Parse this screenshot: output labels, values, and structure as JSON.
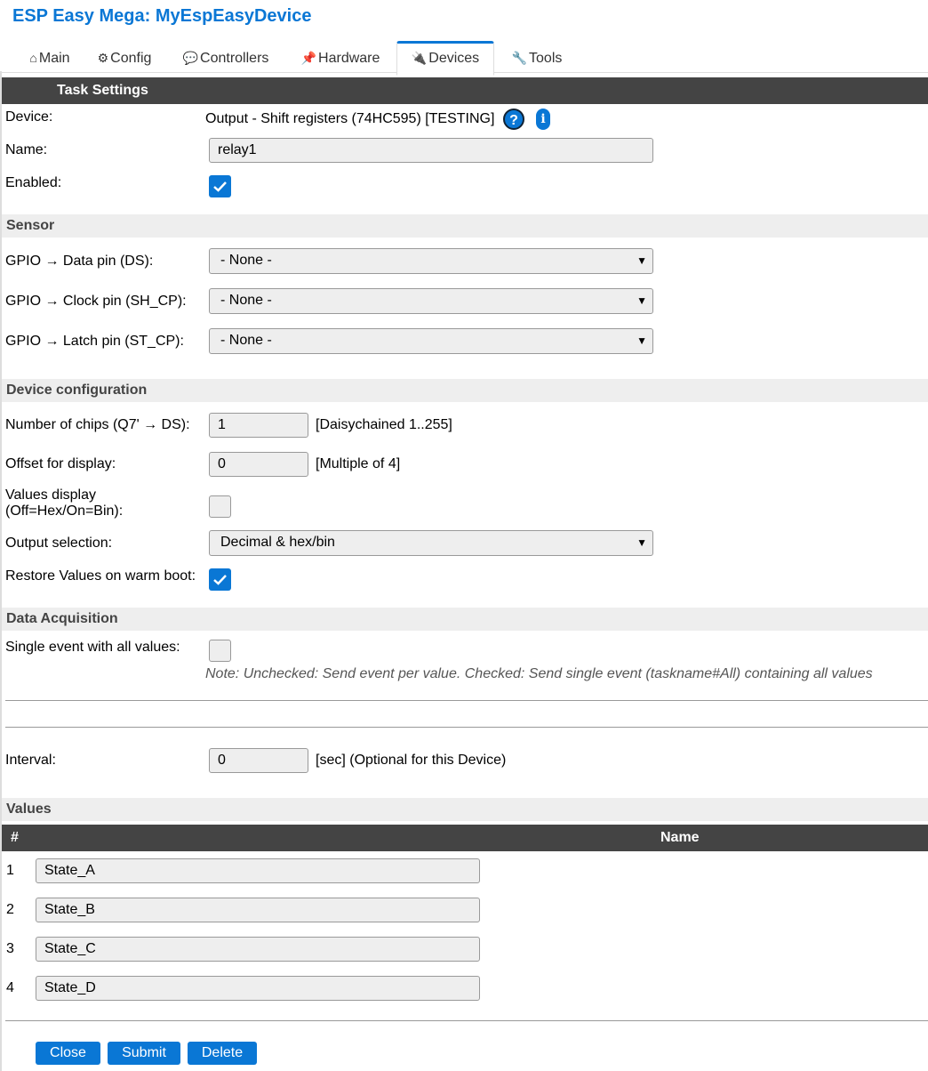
{
  "app": {
    "title": "ESP Easy Mega: MyEspEasyDevice"
  },
  "tabs": [
    {
      "label": "Main",
      "icon": "house-icon",
      "glyph": "⌂"
    },
    {
      "label": "Config",
      "icon": "gear-icon",
      "glyph": "⚙"
    },
    {
      "label": "Controllers",
      "icon": "chat-icon",
      "glyph": "💬"
    },
    {
      "label": "Hardware",
      "icon": "pin-icon",
      "glyph": "📌"
    },
    {
      "label": "Devices",
      "icon": "plug-icon",
      "glyph": "🔌",
      "active": true
    },
    {
      "label": "Tools",
      "icon": "wrench-icon",
      "glyph": "🔧"
    }
  ],
  "task": {
    "header": "Task Settings",
    "device_label": "Device:",
    "device_value": "Output - Shift registers (74HC595) [TESTING]",
    "help_glyph": "?",
    "info_glyph": "i",
    "name_label": "Name:",
    "name_value": "relay1",
    "enabled_label": "Enabled:",
    "enabled": true
  },
  "sensor": {
    "header": "Sensor",
    "rows": [
      {
        "label": "GPIO → Data pin (DS):",
        "value": "- None -"
      },
      {
        "label": "GPIO → Clock pin (SH_CP):",
        "value": "- None -"
      },
      {
        "label": "GPIO → Latch pin (ST_CP):",
        "value": "- None -"
      }
    ]
  },
  "config": {
    "header": "Device configuration",
    "chips_label": "Number of chips (Q7' → DS):",
    "chips_value": "1",
    "chips_hint": "[Daisychained 1..255]",
    "offset_label": "Offset for display:",
    "offset_value": "0",
    "offset_hint": "[Multiple of 4]",
    "values_display_label_1": "Values display",
    "values_display_label_2": "(Off=Hex/On=Bin):",
    "values_display": false,
    "output_label": "Output selection:",
    "output_value": "Decimal & hex/bin",
    "restore_label": "Restore Values on warm boot:",
    "restore": true
  },
  "acquisition": {
    "header": "Data Acquisition",
    "single_event_label": "Single event with all values:",
    "single_event": false,
    "note": "Note: Unchecked: Send event per value. Checked: Send single event (taskname#All) containing all values",
    "interval_label": "Interval:",
    "interval_value": "0",
    "interval_hint": "[sec] (Optional for this Device)"
  },
  "values": {
    "header": "Values",
    "col_num": "#",
    "col_name": "Name",
    "rows": [
      {
        "num": "1",
        "name": "State_A"
      },
      {
        "num": "2",
        "name": "State_B"
      },
      {
        "num": "3",
        "name": "State_C"
      },
      {
        "num": "4",
        "name": "State_D"
      }
    ]
  },
  "buttons": {
    "close": "Close",
    "submit": "Submit",
    "delete": "Delete"
  },
  "colors": {
    "accent": "#0a77d5",
    "header_bg": "#444444",
    "section_bg": "#eeeeee"
  }
}
